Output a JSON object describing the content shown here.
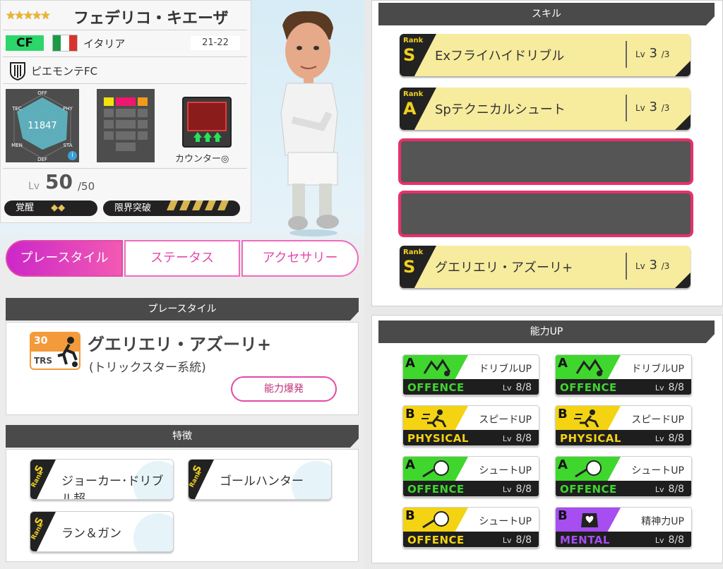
{
  "player": {
    "stars": "★★★★★",
    "name": "フェデリコ・キエーザ",
    "position": "CF",
    "country": "イタリア",
    "season": "21-22",
    "club": "ピエモンテFC",
    "radar": {
      "labels": [
        "OFF",
        "TEC",
        "PHY",
        "MEN",
        "STA",
        "DEF"
      ],
      "score": "11847"
    },
    "skill_tag": "カウンター◎",
    "level_prefix": "Lv",
    "level": "50",
    "level_max": "/50",
    "awaken_label": "覚醒",
    "limit_label": "限界突破"
  },
  "tabs": [
    {
      "label": "プレースタイル",
      "active": true
    },
    {
      "label": "ステータス",
      "active": false
    },
    {
      "label": "アクセサリー",
      "active": false
    }
  ],
  "playstyle": {
    "header": "プレースタイル",
    "icon_number": "30",
    "icon_code": "TRS",
    "name": "グエリエリ・アズーリ+",
    "subtitle": "(トリックスター系統)",
    "button": "能力爆発"
  },
  "traits": {
    "header": "特徴",
    "rank_word": "Rank",
    "items": [
      {
        "rank": "S",
        "label": "ジョーカー･ドリブル超"
      },
      {
        "rank": "S",
        "label": "ゴールハンター"
      },
      {
        "rank": "S",
        "label": "ラン＆ガン"
      }
    ]
  },
  "skills": {
    "header": "スキル",
    "rank_word": "Rank",
    "lv_prefix": "Lv",
    "items": [
      {
        "rank": "S",
        "name": "Exフライハイドリブル",
        "lv": "3",
        "max": "/3"
      },
      {
        "rank": "A",
        "name": "Spテクニカルシュート",
        "lv": "3",
        "max": "/3"
      },
      {
        "rank": "S",
        "name": "グエリエリ・アズーリ+",
        "lv": "3",
        "max": "/3"
      }
    ]
  },
  "ability_up": {
    "header": "能力UP",
    "lv_prefix": "Lv",
    "items": [
      {
        "grade": "A",
        "label": "ドリブルUP",
        "category": "OFFENCE",
        "level": "8/8",
        "color": "#3fd62e",
        "icon": "dribble-icon"
      },
      {
        "grade": "A",
        "label": "ドリブルUP",
        "category": "OFFENCE",
        "level": "8/8",
        "color": "#3fd62e",
        "icon": "dribble-icon"
      },
      {
        "grade": "B",
        "label": "スピードUP",
        "category": "PHYSICAL",
        "level": "8/8",
        "color": "#f3d312",
        "icon": "runner-icon"
      },
      {
        "grade": "B",
        "label": "スピードUP",
        "category": "PHYSICAL",
        "level": "8/8",
        "color": "#f3d312",
        "icon": "runner-icon"
      },
      {
        "grade": "A",
        "label": "シュートUP",
        "category": "OFFENCE",
        "level": "8/8",
        "color": "#3fd62e",
        "icon": "shoot-icon"
      },
      {
        "grade": "A",
        "label": "シュートUP",
        "category": "OFFENCE",
        "level": "8/8",
        "color": "#3fd62e",
        "icon": "shoot-icon"
      },
      {
        "grade": "B",
        "label": "シュートUP",
        "category": "OFFENCE",
        "level": "8/8",
        "color": "#f3d312",
        "icon": "shoot-icon"
      },
      {
        "grade": "B",
        "label": "精神力UP",
        "category": "MENTAL",
        "level": "8/8",
        "color": "#a64ef0",
        "icon": "mental-icon"
      }
    ]
  }
}
